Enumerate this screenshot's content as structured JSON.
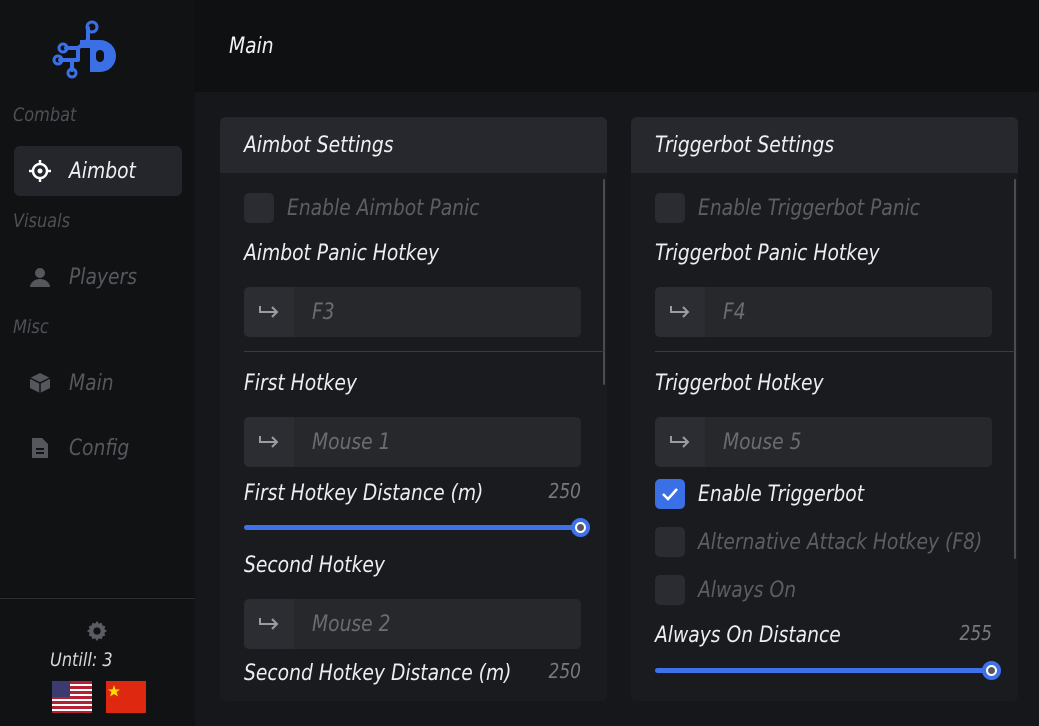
{
  "colors": {
    "accent": "#3d72ea",
    "background": "#0f1012",
    "panel": "#1c1d21",
    "panel_header": "#26282d"
  },
  "sidebar": {
    "logo": "brand-logo",
    "sections": [
      {
        "label": "Combat",
        "items": [
          {
            "label": "Aimbot",
            "icon": "crosshair-icon",
            "active": true
          }
        ]
      },
      {
        "label": "Visuals",
        "items": [
          {
            "label": "Players",
            "icon": "user-icon",
            "active": false
          }
        ]
      },
      {
        "label": "Misc",
        "items": [
          {
            "label": "Main",
            "icon": "box-icon",
            "active": false
          },
          {
            "label": "Config",
            "icon": "document-icon",
            "active": false
          }
        ]
      }
    ],
    "footer": {
      "until_text": "Untill: 3",
      "flags": [
        "us-flag-icon",
        "cn-flag-icon"
      ]
    }
  },
  "header": {
    "title": "Main"
  },
  "aimbot": {
    "title": "Aimbot Settings",
    "panic_label": "Enable Aimbot Panic",
    "panic_checked": false,
    "panic_hotkey_label": "Aimbot Panic Hotkey",
    "panic_hotkey_value": "F3",
    "first_hotkey_label": "First Hotkey",
    "first_hotkey_value": "Mouse 1",
    "first_distance_label": "First Hotkey Distance (m)",
    "first_distance_value": "250",
    "first_distance_fraction": 1.0,
    "second_hotkey_label": "Second Hotkey",
    "second_hotkey_value": "Mouse 2",
    "second_distance_label": "Second Hotkey Distance (m)",
    "second_distance_value": "250"
  },
  "triggerbot": {
    "title": "Triggerbot Settings",
    "panic_label": "Enable Triggerbot Panic",
    "panic_checked": false,
    "panic_hotkey_label": "Triggerbot Panic Hotkey",
    "panic_hotkey_value": "F4",
    "hotkey_label": "Triggerbot Hotkey",
    "hotkey_value": "Mouse 5",
    "enable_label": "Enable Triggerbot",
    "enable_checked": true,
    "alt_attack_label": "Alternative Attack Hotkey (F8)",
    "alt_attack_checked": false,
    "always_on_label": "Always On",
    "always_on_checked": false,
    "always_on_distance_label": "Always On Distance",
    "always_on_distance_value": "255",
    "always_on_distance_fraction": 1.0
  }
}
